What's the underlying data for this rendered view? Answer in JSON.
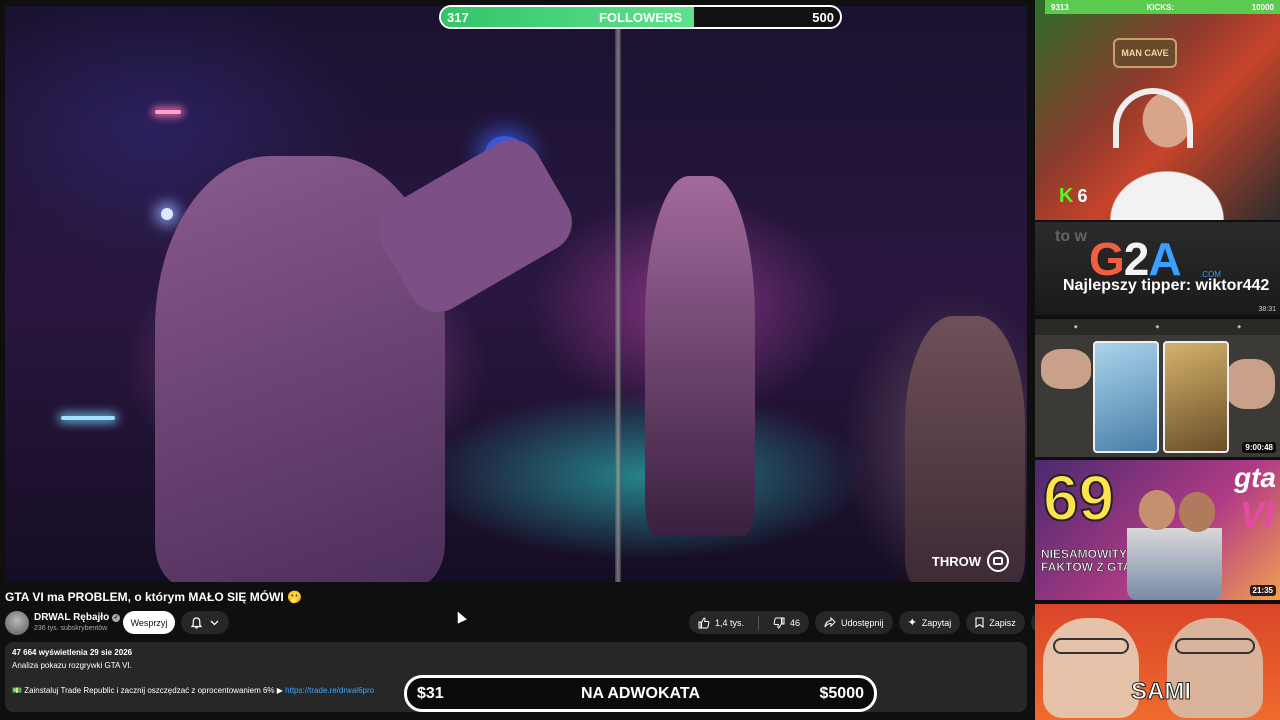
{
  "followers_goal": {
    "current": "317",
    "label": "FOLLOWERS",
    "target": "500",
    "progress": 0.634
  },
  "player": {
    "overlay_label": "THROW"
  },
  "video": {
    "title": "GTA VI ma PROBLEM, o którym MAŁO SIĘ MÓWI 🫢",
    "channel_name": "DRWAL Rębajło",
    "verified_mark": "✓",
    "subscribers": "236 tys. subskrybentów",
    "support_label": "Wesprzyj"
  },
  "actions": {
    "likes": "1,4 tys.",
    "dislikes": "46",
    "share": "Udostępnij",
    "ask": "Zapytaj",
    "save": "Zapisz",
    "more": "⋯"
  },
  "description": {
    "stats": "47 664 wyświetlenia  29 sie 2026",
    "text": "Analiza pokazu rozgrywki GTA VI.",
    "promo_icon": "💵",
    "promo_text": " Zainstaluj Trade Republic i zacznij oszczędzać z oprocentowaniem 6% ▶ ",
    "promo_link": "https://trade.re/drwal6pro"
  },
  "lawyer_goal": {
    "current": "$31",
    "label": "NA ADWOKATA",
    "target": "$5000"
  },
  "sidebar": {
    "cam": {
      "left_stat": "9313",
      "center_stat": "KICKS:",
      "right_stat": "10000",
      "sign": "MAN CAVE",
      "kick_logo": "K",
      "kick_count": "6"
    },
    "g2a": {
      "ghost": "to w",
      "logo_g": "G",
      "logo_2": "2",
      "logo_a": "A",
      "logo_com": ".COM",
      "tipper": "Najlepszy tipper: wiktor442",
      "time": "38:31"
    },
    "thumbs": [
      {
        "time": "9:00:48"
      },
      {
        "number": "69",
        "subtitle": "NIESAMOWITYCH FAKTÓW Z GTA VI",
        "logo": "gta",
        "logo_vi": "VI",
        "time": "21:35"
      },
      {
        "text": "SAMI"
      }
    ]
  }
}
